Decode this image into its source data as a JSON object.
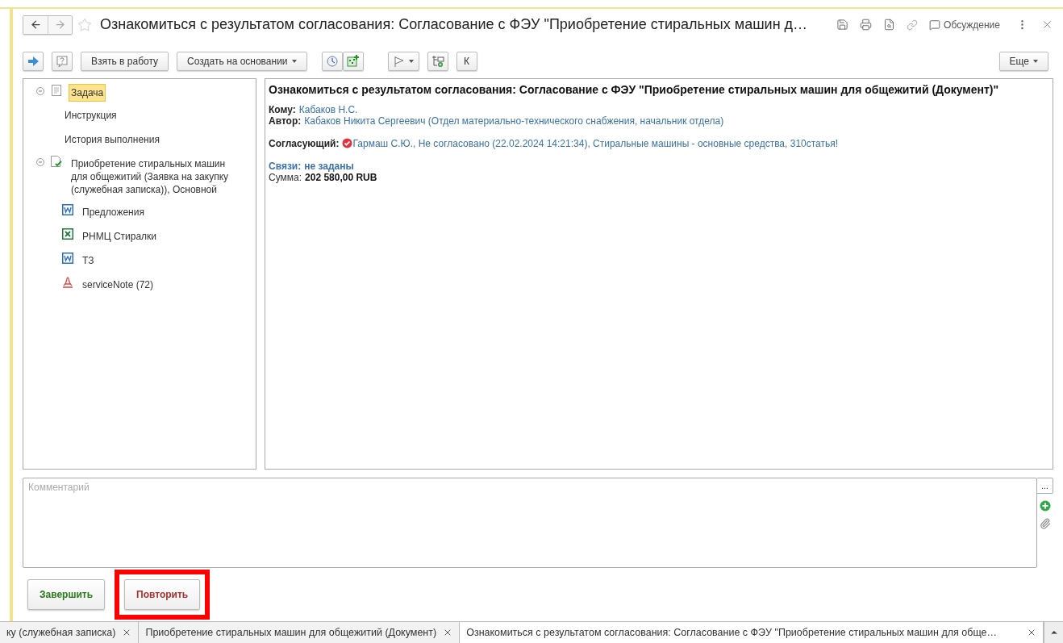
{
  "window": {
    "title": "Ознакомиться с результатом согласования: Согласование с ФЭУ \"Приобретение стиральных машин д…",
    "favorite": false,
    "discussion": "Обсуждение"
  },
  "toolbar": {
    "items": [
      {
        "kind": "go"
      },
      {
        "kind": "help"
      },
      {
        "kind": "text",
        "label": "Взять в работу"
      },
      {
        "kind": "dropdown",
        "label": "Создать на основании"
      },
      {
        "kind": "clock"
      },
      {
        "kind": "sheet-add"
      },
      {
        "kind": "flag"
      },
      {
        "kind": "structure"
      },
      {
        "kind": "text",
        "label": "К"
      }
    ],
    "more": "Еще"
  },
  "tree": [
    {
      "label": "Задача",
      "kind": "task",
      "selected": true,
      "expanded": true,
      "children": [
        {
          "label": "Инструкция",
          "kind": "none",
          "selected": false
        },
        {
          "label": "История выполнения",
          "kind": "none",
          "selected": false
        }
      ]
    },
    {
      "label": "Приобретение стиральных машин для общежитий (Заявка на закупку (служебная записка)), Основной",
      "kind": "approved",
      "selected": false,
      "expanded": true,
      "children": [
        {
          "label": "Предложения",
          "kind": "word",
          "selected": false
        },
        {
          "label": "РНМЦ Стиралки",
          "kind": "excel",
          "selected": false
        },
        {
          "label": "ТЗ",
          "kind": "word",
          "selected": false
        },
        {
          "label": "serviceNote (72)",
          "kind": "pdf",
          "selected": false
        }
      ]
    }
  ],
  "document": {
    "title": "Ознакомиться с результатом согласования: Согласование с ФЭУ \"Приобретение стиральных машин для общежитий (Документ)\"",
    "groups": [
      [
        {
          "label": "Кому:",
          "value": "Кабаков Н.С.",
          "kind": "link"
        },
        {
          "label": "Автор:",
          "value": "Кабаков Никита Сергеевич (Отдел материально-технического снабжения, начальник отдела)",
          "kind": "link"
        }
      ],
      [
        {
          "label": "Согласующий:",
          "value": "Гармаш С.Ю., Не согласовано (22.02.2024 14:21:34), Стиральные машины - основные средства, 310статья!",
          "kind": "approver"
        }
      ],
      [
        {
          "label": "Связи:",
          "value": "не заданы",
          "kind": "relations"
        },
        {
          "label": "Сумма:",
          "value": "202 580,00 RUB",
          "kind": "amount"
        }
      ]
    ]
  },
  "comment": {
    "placeholder": "Комментарий",
    "choose": "..."
  },
  "actions": [
    {
      "label": "Завершить",
      "kind": "complete",
      "highlighted": false
    },
    {
      "label": "Повторить",
      "kind": "repeat",
      "highlighted": true
    }
  ],
  "open_tabs": [
    {
      "label": "ку (служебная записка)",
      "selected": false
    },
    {
      "label": "Приобретение стиральных машин для общежитий (Документ)",
      "selected": false
    },
    {
      "label": "Ознакомиться с результатом согласования: Согласование с ФЭУ \"Приобретение стиральных машин для обще…",
      "selected": true
    }
  ]
}
